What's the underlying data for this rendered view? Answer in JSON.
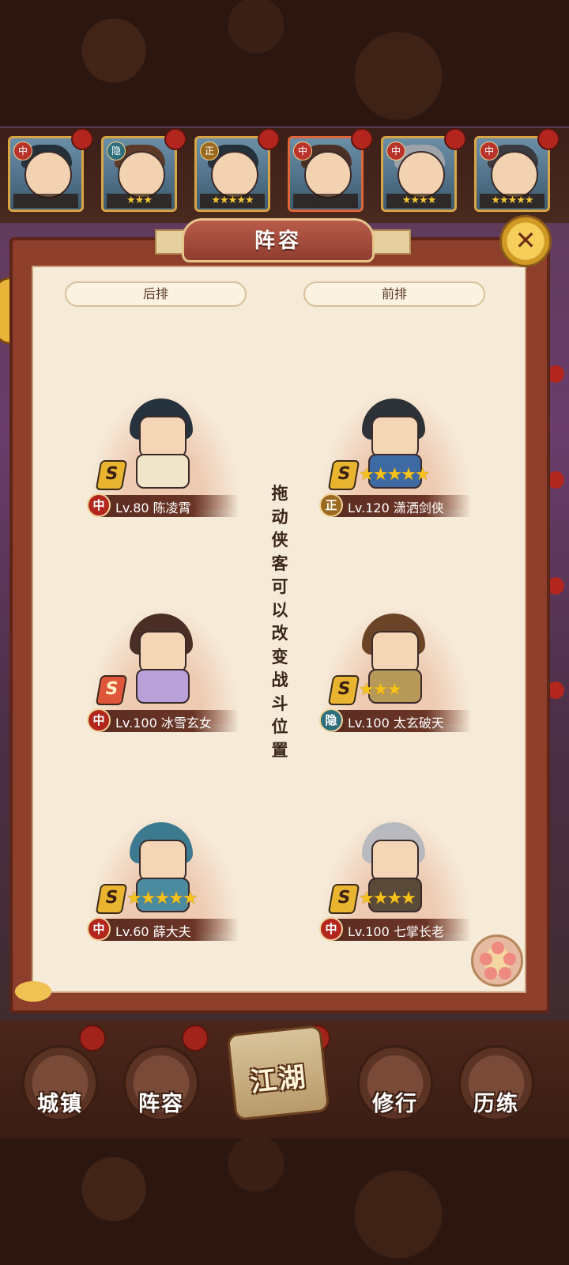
{
  "hero_strip": [
    {
      "tag": "中",
      "stars": "",
      "selected": false
    },
    {
      "tag": "隐",
      "stars": "★★★",
      "selected": false
    },
    {
      "tag": "正",
      "stars": "★★★★★",
      "selected": false
    },
    {
      "tag": "中",
      "stars": "",
      "selected": true
    },
    {
      "tag": "中",
      "stars": "★★★★",
      "selected": false
    },
    {
      "tag": "中",
      "stars": "★★★★★",
      "selected": false
    }
  ],
  "panel": {
    "title": "阵容",
    "back_row_label": "后排",
    "front_row_label": "前排",
    "drag_hint": "拖动侠客可以改变战斗位置"
  },
  "heroes": [
    {
      "row": "back",
      "slot": 1,
      "faction": "中",
      "grade": "S",
      "stars": "",
      "name": "Lv.80 陈凌霄",
      "hair": "#26323d",
      "robe": "#efe5c8"
    },
    {
      "row": "front",
      "slot": 1,
      "faction": "正",
      "grade": "S",
      "stars": "★★★★★",
      "name": "Lv.120 潇洒剑侠",
      "hair": "#2d3138",
      "robe": "#3e6aa3"
    },
    {
      "row": "back",
      "slot": 2,
      "faction": "中",
      "grade": "S",
      "stars": "",
      "name": "Lv.100 冰雪玄女",
      "hair": "#4a2e25",
      "robe": "#b7a1d8"
    },
    {
      "row": "front",
      "slot": 2,
      "faction": "隐",
      "grade": "S",
      "stars": "★★★",
      "name": "Lv.100 太玄破天",
      "hair": "#6b4428",
      "robe": "#b79a5a"
    },
    {
      "row": "back",
      "slot": 3,
      "faction": "中",
      "grade": "S",
      "stars": "★★★★★",
      "name": "Lv.60 薛大夫",
      "hair": "#3c7a90",
      "robe": "#4c8a9f"
    },
    {
      "row": "front",
      "slot": 3,
      "faction": "中",
      "grade": "S",
      "stars": "★★★★",
      "name": "Lv.100 七掌长老",
      "hair": "#b9b9c0",
      "robe": "#5a4a3a"
    }
  ],
  "bottom_nav": [
    {
      "label": "城镇"
    },
    {
      "label": "阵容"
    },
    {
      "label": "江湖"
    },
    {
      "label": "修行"
    },
    {
      "label": "历练"
    }
  ],
  "colors": {
    "panel_bg": "#f6ead8",
    "frame": "#8d3f2c",
    "star": "#f7c21b",
    "badge_red": "#b3261e"
  }
}
